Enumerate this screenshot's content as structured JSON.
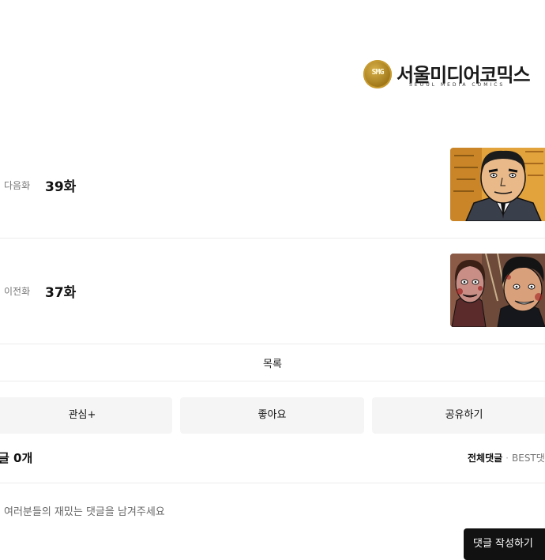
{
  "publisher": {
    "seal_text": "SMG",
    "name_ko": "서울미디어코믹스",
    "name_en": "SEOUL MEDIA COMICS",
    "brand_color": "#b8892a"
  },
  "episodes": {
    "next": {
      "kind_label": "다음화",
      "title": "39화"
    },
    "prev": {
      "kind_label": "이전화",
      "title": "37화"
    }
  },
  "list": {
    "label": "목록"
  },
  "actions": {
    "interest_label": "관심+",
    "like_label": "좋아요",
    "share_label": "공유하기"
  },
  "comments": {
    "count_label": "글 0개",
    "tab_all": "전체댓글",
    "tab_separator": "·",
    "tab_best": "BEST댓",
    "placeholder": "여러분들의 재밌는 댓글을 남겨주세요",
    "write_button": "댓글 작성하기"
  },
  "colors": {
    "background": "#ffffff",
    "divider": "#ececec",
    "button_bg": "#f5f5f5",
    "dark_button": "#111111"
  }
}
